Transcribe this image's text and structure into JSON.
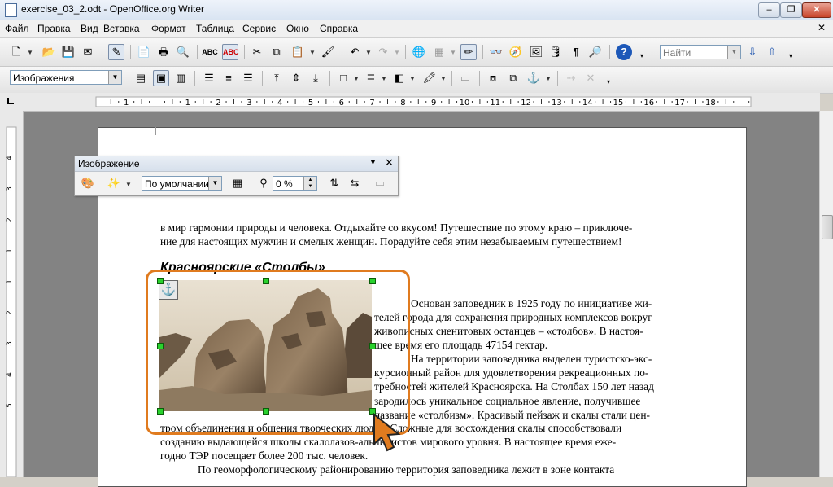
{
  "window": {
    "title": "exercise_03_2.odt - OpenOffice.org Writer",
    "minimize": "–",
    "restore": "❐",
    "close": "✕"
  },
  "menu": [
    "Файл",
    "Правка",
    "Вид",
    "Вставка",
    "Формат",
    "Таблица",
    "Сервис",
    "Окно",
    "Справка"
  ],
  "menu_close": "✕",
  "toolbar": {
    "find_placeholder": "Найти"
  },
  "formatting": {
    "style": "Изображения"
  },
  "ruler": {
    "numbers": [
      "1",
      "1",
      "2",
      "3",
      "4",
      "5",
      "6",
      "7",
      "8",
      "9",
      "10",
      "11",
      "12",
      "13",
      "14",
      "15",
      "16",
      "17",
      "18"
    ],
    "vnumbers": [
      "4",
      "3",
      "2",
      "1",
      "1",
      "2",
      "3",
      "4",
      "5"
    ]
  },
  "image_toolbar": {
    "title": "Изображение",
    "filter_mode": "По умолчании",
    "transparency": "0 %"
  },
  "document": {
    "line1": "в мир гармонии природы и человека. Отдыхайте со вкусом! Путешествие по этому краю – приключе-",
    "line2": "ние для настоящих мужчин и смелых женщин. Порадуйте себя этим незабываемым путешествием!",
    "heading": "Красноярские «Столбы»",
    "wrap": [
      "Основан заповедник в 1925 году по инициативе жи-",
      "телей города для сохранения природных комплексов вокруг",
      "живописных сиенитовых останцев – «столбов». В настоя-",
      "щее время его площадь 47154 гектар.",
      "На территории заповедника выделен туристско-экс-",
      "курсионный район для удовлетворения рекреационных по-",
      "требностей жителей Красноярска. На Столбах 150 лет назад",
      "зародилось уникальное социальное явление, получившее",
      "название «столбизм». Красивый пейзаж и скалы стали цен-"
    ],
    "full": [
      "тром объединения и общения творческих людей. Сложные для восхождения скалы способствовали",
      "созданию выдающейся школы скалолазов-альпинистов мирового уровня. В настоящее время еже-",
      "годно ТЭР посещает более 200 тыс. человек.",
      "По геоморфологическому районированию территория заповедника лежит в зоне контакта"
    ]
  },
  "colors": {
    "highlight": "#e07b1f",
    "handle": "#29d12d",
    "sepia": "#8b7358"
  }
}
